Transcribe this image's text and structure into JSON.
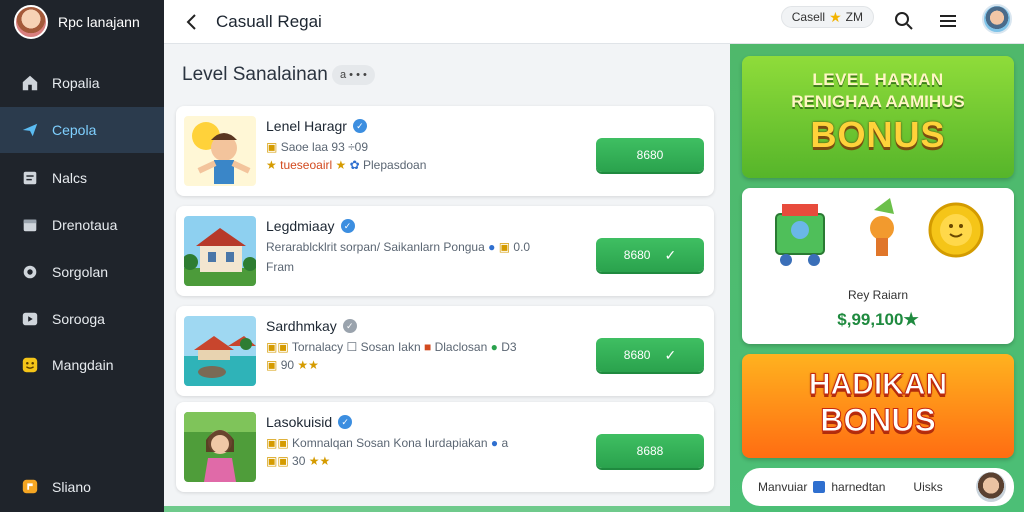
{
  "sidebar": {
    "title": "Rpc lanajann",
    "items": [
      {
        "label": "Ropalia",
        "icon": "home-icon"
      },
      {
        "label": "Cepola",
        "icon": "send-icon"
      },
      {
        "label": "Nalcs",
        "icon": "notes-icon"
      },
      {
        "label": "Drenotaua",
        "icon": "calendar-icon"
      },
      {
        "label": "Sorgolan",
        "icon": "circle-icon"
      },
      {
        "label": "Sorooga",
        "icon": "play-icon"
      },
      {
        "label": "Mangdain",
        "icon": "smile-icon"
      },
      {
        "label": "Sliano",
        "icon": "chat-icon"
      }
    ],
    "active_index": 1
  },
  "topbar": {
    "title": "Casuall Regai",
    "chip_left": "Casell",
    "chip_right": "ZM"
  },
  "main": {
    "section_title": "Level Sanalainan",
    "pill": "a • • •",
    "cards": [
      {
        "title": "Lenel Haragr",
        "line1": "Saoe laa  93 ÷09",
        "line2_a": "tueseoairl",
        "line2_b": "Plepasdoan",
        "button": "8680",
        "check": false
      },
      {
        "title": "Legdmiaay",
        "line1": "Rerarablcklrit sorpan/ Saikanlarn Pongua",
        "line1_tail": "0.0",
        "line2_a": "Fram",
        "line2_b": "",
        "button": "8680",
        "check": true
      },
      {
        "title": "Sardhmkay",
        "line1": "Tornalacy ☐ Sosan Iakn",
        "line1_mid": "Dlaclosan",
        "line1_tail": "D3",
        "line2_a": "90",
        "line2_b": "",
        "button": "8680",
        "check": true
      },
      {
        "title": "Lasokuisid",
        "line1": "Komnalqan Sosan Kona Iurdapiakan",
        "line1_tail": "a",
        "line2_a": "30",
        "line2_b": "",
        "button": "8688",
        "check": false
      }
    ]
  },
  "right": {
    "banner1": {
      "line1": "LEVEL HARIAN",
      "line2": "RENIGHAA AAMIHUS",
      "line3": "BONUS"
    },
    "prize": {
      "label": "Rey Raiarn",
      "amount": "$,99,100★"
    },
    "banner2": {
      "line1": "HADIKAN",
      "line2": "BONUS"
    },
    "footer": {
      "left": "Manvuiar",
      "mid": "harnedtan",
      "right": "Uisks"
    }
  },
  "colors": {
    "accent_green": "#2aa24d",
    "sidebar_bg": "#1f242b",
    "active_text": "#7fd0ff"
  }
}
